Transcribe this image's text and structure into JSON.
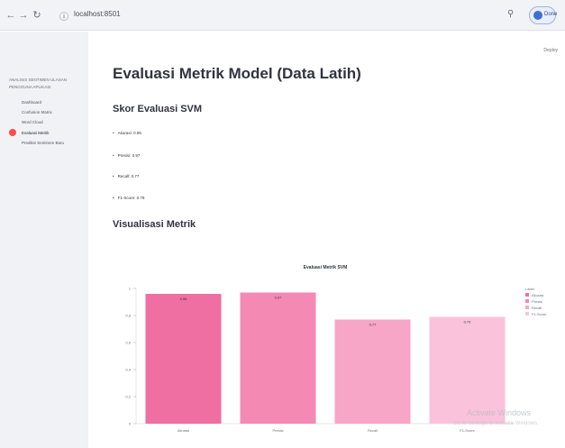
{
  "browser": {
    "url": "localhost:8501",
    "profile_label": "Done"
  },
  "sidebar": {
    "heading": "ANALISIS SENTIMEN ULASAN PENGGUNA APLIKASI",
    "items": [
      {
        "label": "Dashboard"
      },
      {
        "label": "Confusion Matrix"
      },
      {
        "label": "Word Cloud"
      },
      {
        "label": "Evaluasi Metrik"
      },
      {
        "label": "Prediksi Sentimen Baru"
      }
    ]
  },
  "header": {
    "menu_label": "Deploy"
  },
  "main": {
    "title": "Evaluasi Metrik Model (Data Latih)",
    "subtitle": "Skor Evaluasi SVM",
    "metrics": [
      {
        "text": "Akurasi: 0.96"
      },
      {
        "text": "Presisi: 0.97"
      },
      {
        "text": "Recall: 0.77"
      },
      {
        "text": "F1-Score: 0.79"
      }
    ],
    "subtitle2": "Visualisasi Metrik"
  },
  "chart_data": {
    "type": "bar",
    "title": "Evaluasi Metrik SVM",
    "categories": [
      "Akurasi",
      "Presisi",
      "Recall",
      "F1-Score"
    ],
    "values": [
      0.96,
      0.97,
      0.77,
      0.79
    ],
    "colors": [
      "#f06fa3",
      "#f489b4",
      "#f7a6c8",
      "#fac3db"
    ],
    "ylim": [
      0,
      1.0
    ],
    "yticks": [
      "0",
      "0.2",
      "0.4",
      "0.6",
      "0.8",
      "1"
    ],
    "ylabel": "",
    "xlabel": "",
    "legend": {
      "title": "Label",
      "position": "right",
      "entries": [
        "Akurasi",
        "Presisi",
        "Recall",
        "F1-Score"
      ]
    }
  },
  "watermark": {
    "title": "Activate Windows",
    "subtitle": "Go to Settings to activate Windows."
  }
}
